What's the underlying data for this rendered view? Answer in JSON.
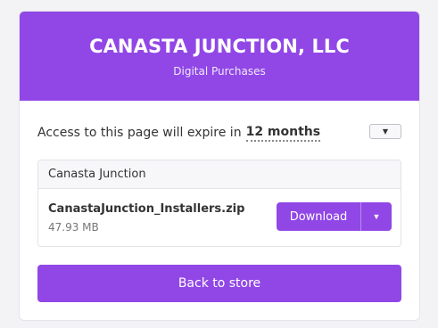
{
  "header": {
    "title": "CANASTA JUNCTION, LLC",
    "subtitle": "Digital Purchases"
  },
  "access": {
    "prefix": "Access to this page will expire in",
    "duration": "12 months",
    "dropdown_icon": "caret-down-icon",
    "dropdown_glyph": "▼"
  },
  "files": {
    "group_title": "Canasta Junction",
    "items": [
      {
        "name": "CanastaJunction_Installers.zip",
        "size": "47.93 MB",
        "download_label": "Download",
        "caret_glyph": "▼"
      }
    ]
  },
  "back_label": "Back to store",
  "colors": {
    "accent": "#9147e6",
    "background": "#f3f3f5"
  }
}
